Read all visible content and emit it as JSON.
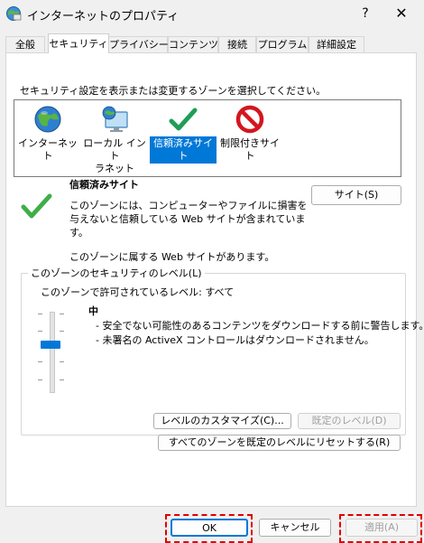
{
  "window": {
    "title": "インターネットのプロパティ",
    "help": "?",
    "close": "✕"
  },
  "tabs": [
    {
      "label": "全般"
    },
    {
      "label": "セキュリティ",
      "active": true
    },
    {
      "label": "プライバシー"
    },
    {
      "label": "コンテンツ"
    },
    {
      "label": "接続"
    },
    {
      "label": "プログラム"
    },
    {
      "label": "詳細設定"
    }
  ],
  "security": {
    "instruction": "セキュリティ設定を表示または変更するゾーンを選択してください。",
    "zones": [
      {
        "label": "インターネット",
        "icon": "globe-icon"
      },
      {
        "label": "ローカル イント\nラネット",
        "icon": "monitor-globe-icon"
      },
      {
        "label": "信頼済みサイ\nト",
        "icon": "green-check-icon",
        "selected": true
      },
      {
        "label": "制限付きサイ\nト",
        "icon": "prohibited-icon"
      }
    ],
    "selected_zone": {
      "name": "信頼済みサイト",
      "description": "このゾーンには、コンピューターやファイルに損害を与えないと信頼している Web サイトが含まれています。",
      "sites_button": "サイト(S)",
      "websites_note": "このゾーンに属する Web サイトがあります。"
    },
    "level_group": {
      "title": "このゾーンのセキュリティのレベル(L)",
      "allowed": "このゾーンで許可されているレベル: すべて",
      "level_name": "中",
      "bullets": [
        "- 安全でない可能性のあるコンテンツをダウンロードする前に警告します。",
        "- 未署名の ActiveX コントロールはダウンロードされません。"
      ],
      "slider_position": "middle",
      "custom_button": "レベルのカスタマイズ(C)...",
      "default_button": "既定のレベル(D)",
      "reset_button": "すべてのゾーンを既定のレベルにリセットする(R)"
    }
  },
  "footer": {
    "ok": "OK",
    "cancel": "キャンセル",
    "apply": "適用(A)"
  },
  "colors": {
    "accent": "#0078d7",
    "annotation": "#e00000"
  }
}
